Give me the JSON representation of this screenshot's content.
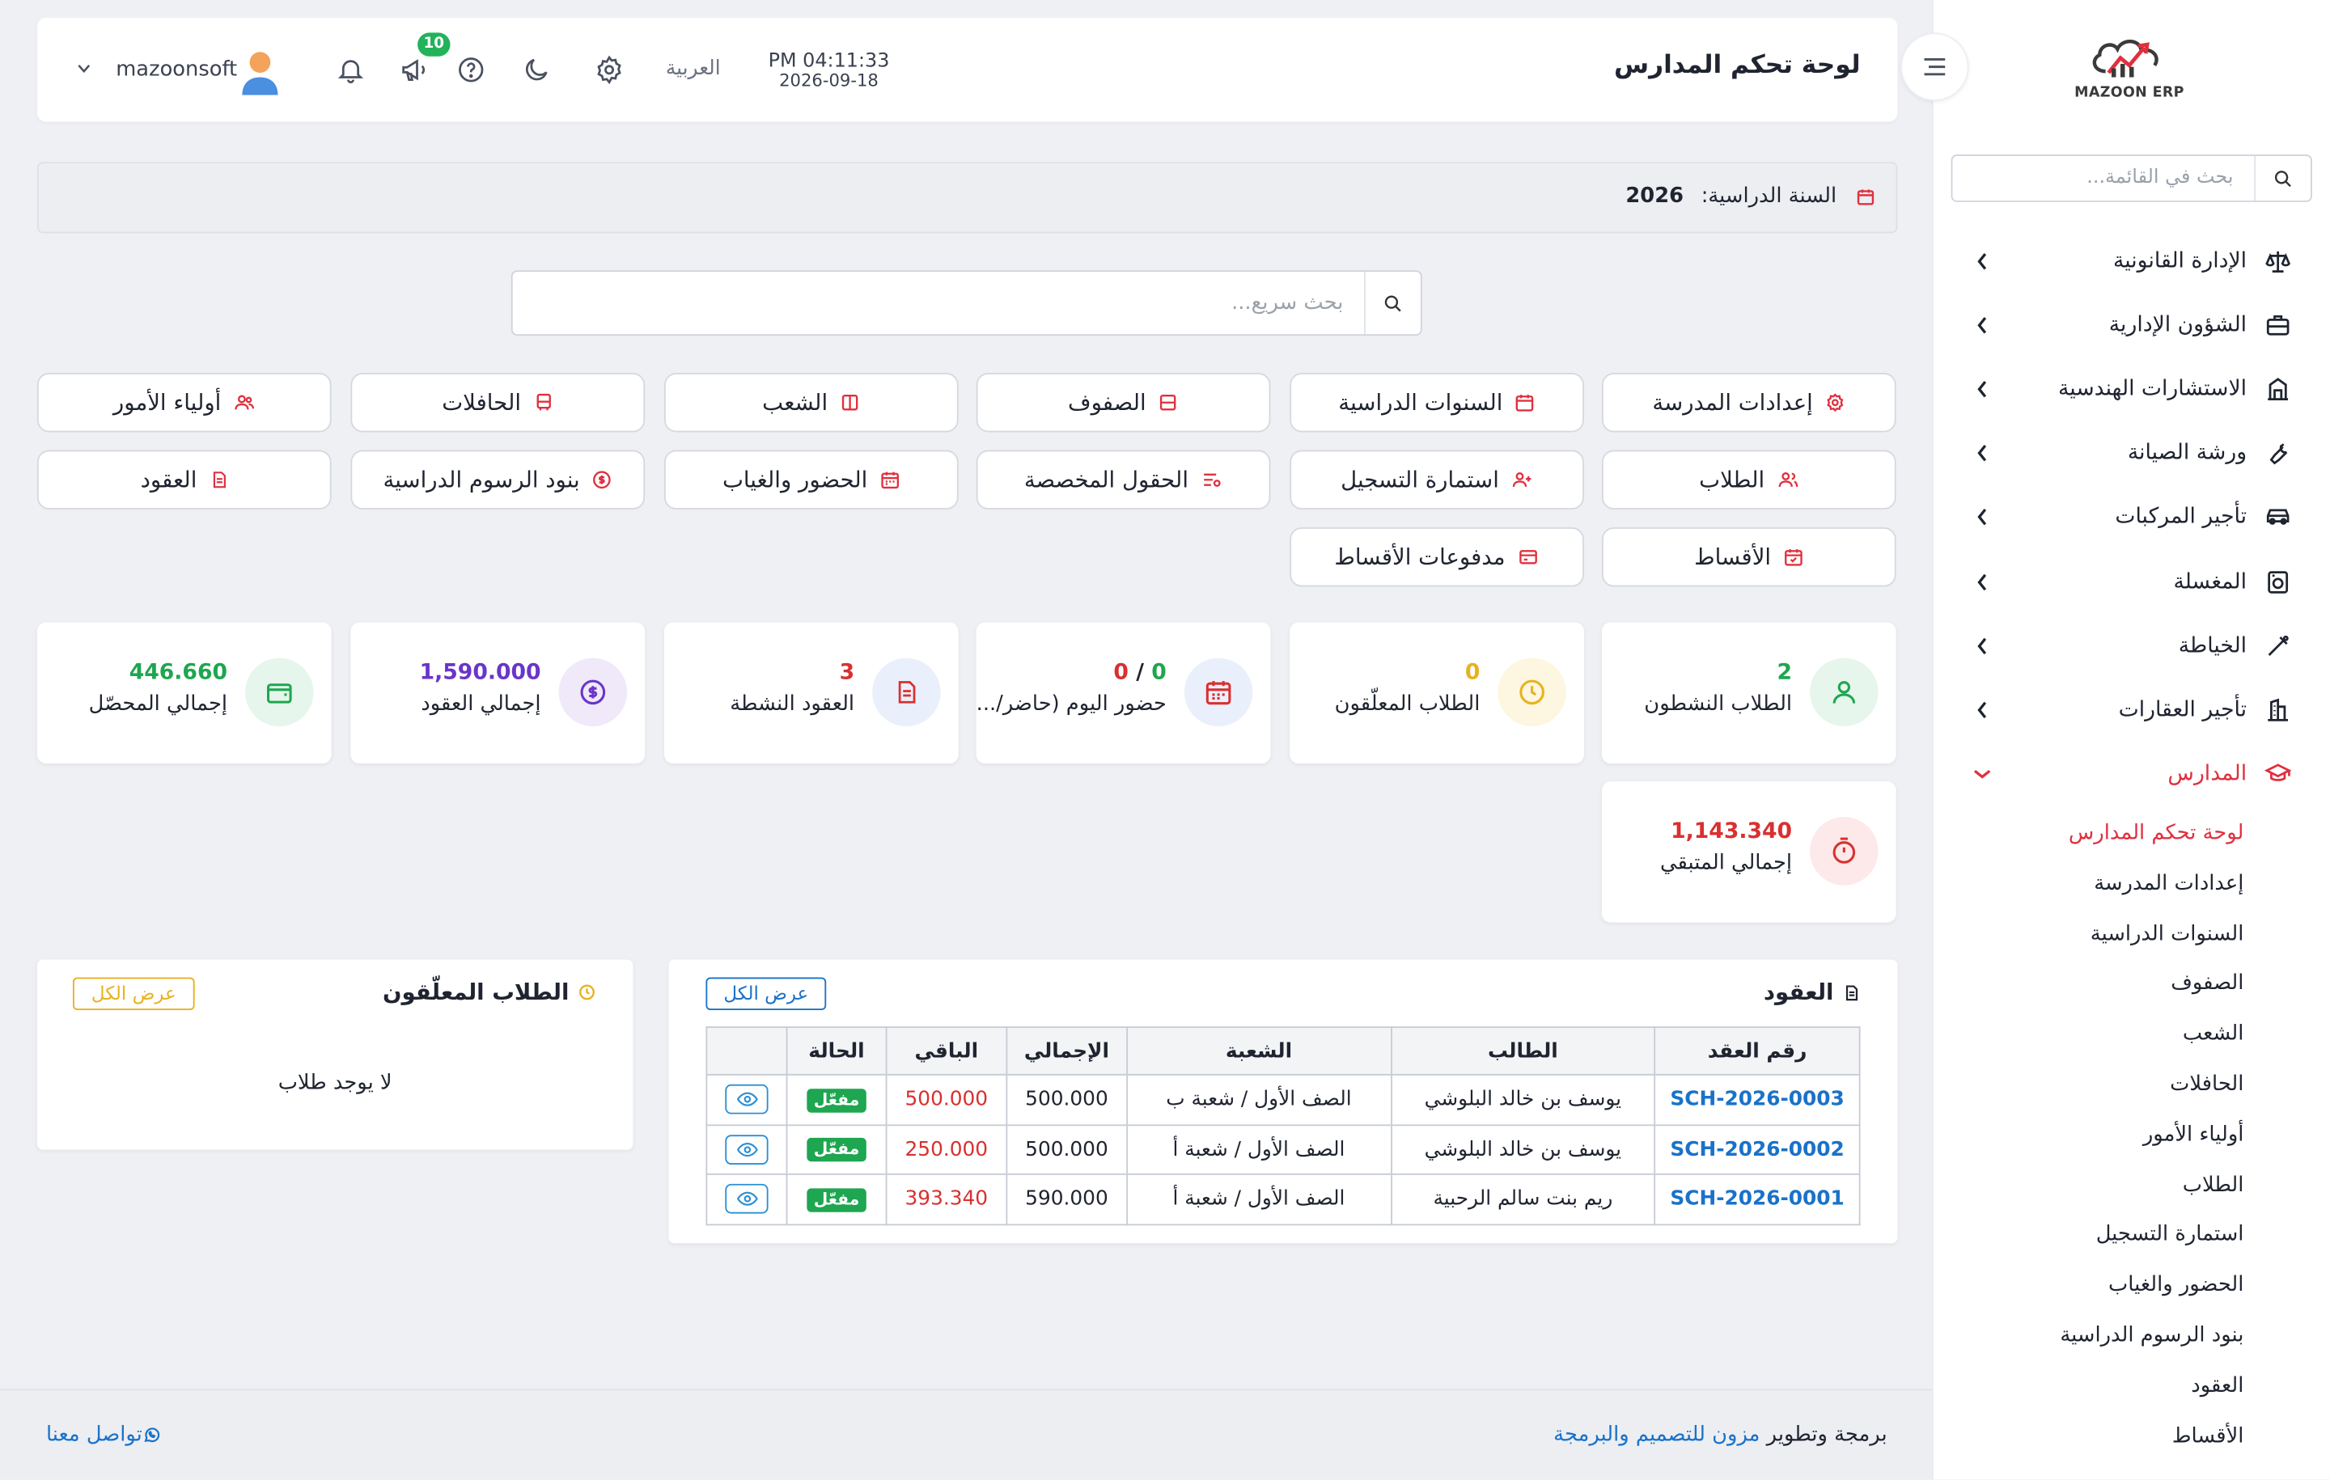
{
  "sidebar": {
    "logo_text": "MAZOON ERP",
    "search_placeholder": "بحث في القائمة...",
    "items": [
      {
        "label": "الإدارة القانونية",
        "icon": "scale-icon"
      },
      {
        "label": "الشؤون الإدارية",
        "icon": "briefcase-icon"
      },
      {
        "label": "الاستشارات الهندسية",
        "icon": "building-icon"
      },
      {
        "label": "ورشة الصيانة",
        "icon": "wrench-icon"
      },
      {
        "label": "تأجير المركبات",
        "icon": "car-icon"
      },
      {
        "label": "المغسلة",
        "icon": "laundry-icon"
      },
      {
        "label": "الخياطة",
        "icon": "sewing-icon"
      },
      {
        "label": "تأجير العقارات",
        "icon": "real-estate-icon"
      },
      {
        "label": "المدارس",
        "icon": "graduation-cap-icon"
      }
    ],
    "sub_items": [
      "لوحة تحكم المدارس",
      "إعدادات المدرسة",
      "السنوات الدراسية",
      "الصفوف",
      "الشعب",
      "الحافلات",
      "أولياء الأمور",
      "الطلاب",
      "استمارة التسجيل",
      "الحضور والغياب",
      "بنود الرسوم الدراسية",
      "العقود",
      "الأقساط"
    ]
  },
  "header": {
    "title": "لوحة تحكم المدارس",
    "time": "PM 04:11:33",
    "date": "2026-09-18",
    "language": "العربية",
    "notifications_count": "10",
    "username": "mazoonsoft"
  },
  "year_bar": {
    "label": "السنة الدراسية:",
    "value": "2026"
  },
  "quick_search": {
    "placeholder": "بحث سريع..."
  },
  "quick_links": [
    {
      "label": "إعدادات المدرسة",
      "icon": "gear-icon"
    },
    {
      "label": "السنوات الدراسية",
      "icon": "calendar-icon"
    },
    {
      "label": "الصفوف",
      "icon": "layers-icon"
    },
    {
      "label": "الشعب",
      "icon": "columns-icon"
    },
    {
      "label": "الحافلات",
      "icon": "bus-icon"
    },
    {
      "label": "أولياء الأمور",
      "icon": "users-icon"
    },
    {
      "label": "الطلاب",
      "icon": "user-group-icon"
    },
    {
      "label": "استمارة التسجيل",
      "icon": "user-plus-icon"
    },
    {
      "label": "الحقول المخصصة",
      "icon": "custom-fields-icon"
    },
    {
      "label": "الحضور والغياب",
      "icon": "attendance-icon"
    },
    {
      "label": "بنود الرسوم الدراسية",
      "icon": "fee-icon"
    },
    {
      "label": "العقود",
      "icon": "document-icon"
    },
    {
      "label": "الأقساط",
      "icon": "calendar-check-icon"
    },
    {
      "label": "مدفوعات الأقساط",
      "icon": "payment-icon"
    }
  ],
  "stats": [
    {
      "value": "2",
      "label": "الطلاب النشطون",
      "color": "#1ea650",
      "bg": "#e6f6ec",
      "icon": "user-icon"
    },
    {
      "value": "0",
      "label": "الطلاب المعلّقون",
      "color": "#e8b21f",
      "bg": "#fdf6e0",
      "icon": "clock-icon"
    },
    {
      "value_present": "0",
      "value_sep": " / ",
      "value_absent": "0",
      "label": "حضور اليوم (حاضر/...",
      "icon": "calendar-icon"
    },
    {
      "value": "3",
      "label": "العقود النشطة",
      "color": "#d93030",
      "bg": "#eaf0fb",
      "icon": "document-icon"
    },
    {
      "value": "1,590.000",
      "label": "إجمالي العقود",
      "color": "#6a35c9",
      "bg": "#efe9fa",
      "icon": "dollar-icon"
    },
    {
      "value": "446.660",
      "label": "إجمالي المحصّل",
      "color": "#1ea650",
      "bg": "#e6f6ec",
      "icon": "wallet-icon"
    },
    {
      "value": "1,143.340",
      "label": "إجمالي المتبقي",
      "color": "#d93030",
      "bg": "#fde9ea",
      "icon": "timer-icon"
    }
  ],
  "contracts_panel": {
    "title": "العقود",
    "view_all": "عرض الكل",
    "columns": [
      "رقم العقد",
      "الطالب",
      "الشعبة",
      "الإجمالي",
      "الباقي",
      "الحالة",
      ""
    ],
    "rows": [
      {
        "code": "SCH-2026-0003",
        "student": "يوسف بن خالد البلوشي",
        "section": "الصف الأول / شعبة ب",
        "total": "500.000",
        "remaining": "500.000",
        "status": "مفعّل"
      },
      {
        "code": "SCH-2026-0002",
        "student": "يوسف بن خالد البلوشي",
        "section": "الصف الأول / شعبة أ",
        "total": "500.000",
        "remaining": "250.000",
        "status": "مفعّل"
      },
      {
        "code": "SCH-2026-0001",
        "student": "ريم بنت سالم الرحبية",
        "section": "الصف الأول / شعبة أ",
        "total": "590.000",
        "remaining": "393.340",
        "status": "مفعّل"
      }
    ]
  },
  "pending_panel": {
    "title": "الطلاب المعلّقون",
    "view_all": "عرض الكل",
    "empty": "لا يوجد طلاب"
  },
  "footer": {
    "prefix": "برمجة وتطوير",
    "company": "مزون للتصميم والبرمجة",
    "contact": "تواصل معنا"
  },
  "colors": {
    "accent": "#e0303e",
    "link": "#1a72c9",
    "success": "#1ea650"
  }
}
